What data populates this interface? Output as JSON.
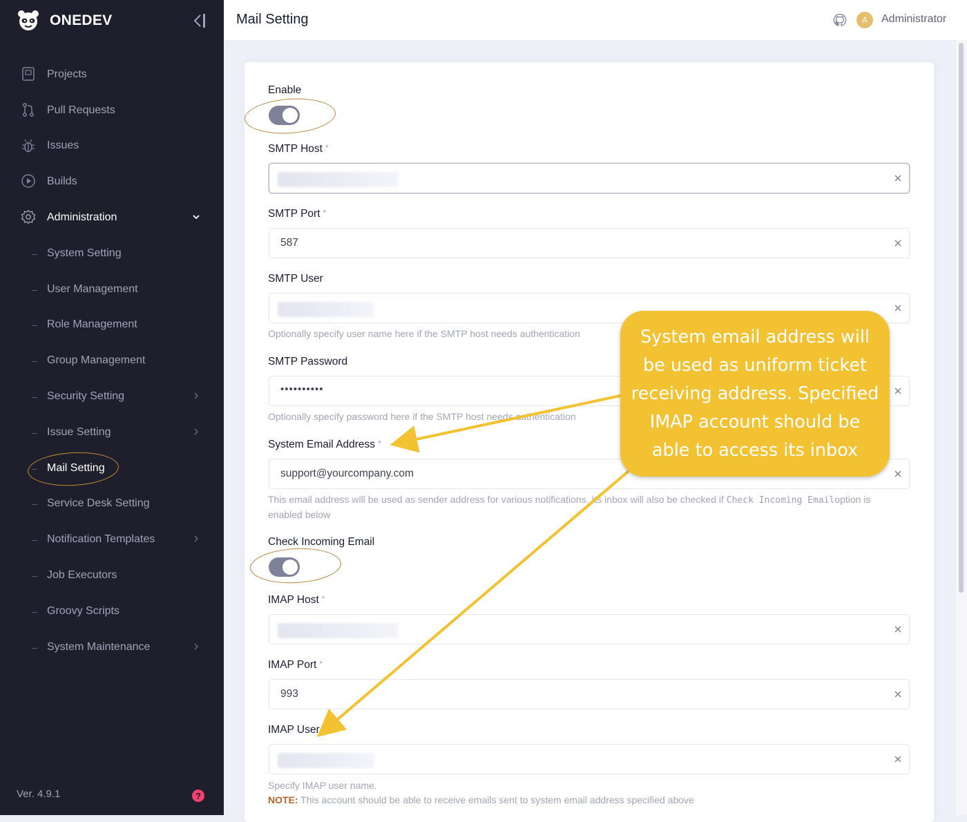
{
  "app": {
    "name": "ONEDEV",
    "version": "Ver. 4.9.1",
    "help_glyph": "?"
  },
  "header": {
    "title": "Mail Setting",
    "user_initial": "A",
    "user_name": "Administrator"
  },
  "sidebar": {
    "items": [
      {
        "label": "Projects",
        "icon": "projects-icon"
      },
      {
        "label": "Pull Requests",
        "icon": "pull-request-icon"
      },
      {
        "label": "Issues",
        "icon": "bug-icon"
      },
      {
        "label": "Builds",
        "icon": "play-circle-icon"
      },
      {
        "label": "Administration",
        "icon": "gear-icon",
        "expanded": true
      }
    ],
    "sub_items": [
      {
        "label": "System Setting"
      },
      {
        "label": "User Management"
      },
      {
        "label": "Role Management"
      },
      {
        "label": "Group Management"
      },
      {
        "label": "Security Setting",
        "has_children": true
      },
      {
        "label": "Issue Setting",
        "has_children": true
      },
      {
        "label": "Mail Setting",
        "active": true
      },
      {
        "label": "Service Desk Setting"
      },
      {
        "label": "Notification Templates",
        "has_children": true
      },
      {
        "label": "Job Executors"
      },
      {
        "label": "Groovy Scripts"
      },
      {
        "label": "System Maintenance",
        "has_children": true
      }
    ]
  },
  "form": {
    "enable": {
      "label": "Enable",
      "checked": true
    },
    "smtp_host": {
      "label": "SMTP Host",
      "required_mark": "*",
      "value_hidden": true
    },
    "smtp_port": {
      "label": "SMTP Port",
      "required_mark": "*",
      "value": "587"
    },
    "smtp_user": {
      "label": "SMTP User",
      "value_hidden": true,
      "help": "Optionally specify user name here if the SMTP host needs authentication"
    },
    "smtp_password": {
      "label": "SMTP Password",
      "value": "••••••••••",
      "help": "Optionally specify password here if the SMTP host needs authentication"
    },
    "system_email": {
      "label": "System Email Address",
      "required_mark": "*",
      "value": "support@yourcompany.com",
      "help_before": "This email address will be used as sender address for various notifications. Its inbox will also be checked if ",
      "help_code": "Check Incoming Email",
      "help_after": "option is enabled below"
    },
    "check_incoming": {
      "label": "Check Incoming Email",
      "checked": true
    },
    "imap_host": {
      "label": "IMAP Host",
      "required_mark": "*",
      "value_hidden": true
    },
    "imap_port": {
      "label": "IMAP Port",
      "required_mark": "*",
      "value": "993"
    },
    "imap_user": {
      "label": "IMAP User",
      "value_hidden": true,
      "help": "Specify IMAP user name.",
      "note_label": "NOTE:",
      "note": " This account should be able to receive emails sent to system email address specified above"
    }
  },
  "annotation": {
    "callout_text": "System email address will be used as uniform ticket receiving address. Specified IMAP account should be able to access its inbox",
    "color": "#f2c232"
  },
  "colors": {
    "sidebar_bg": "#1e1e2d",
    "toggle_on": "#7e8299",
    "highlight_ring": "#b5843a"
  }
}
